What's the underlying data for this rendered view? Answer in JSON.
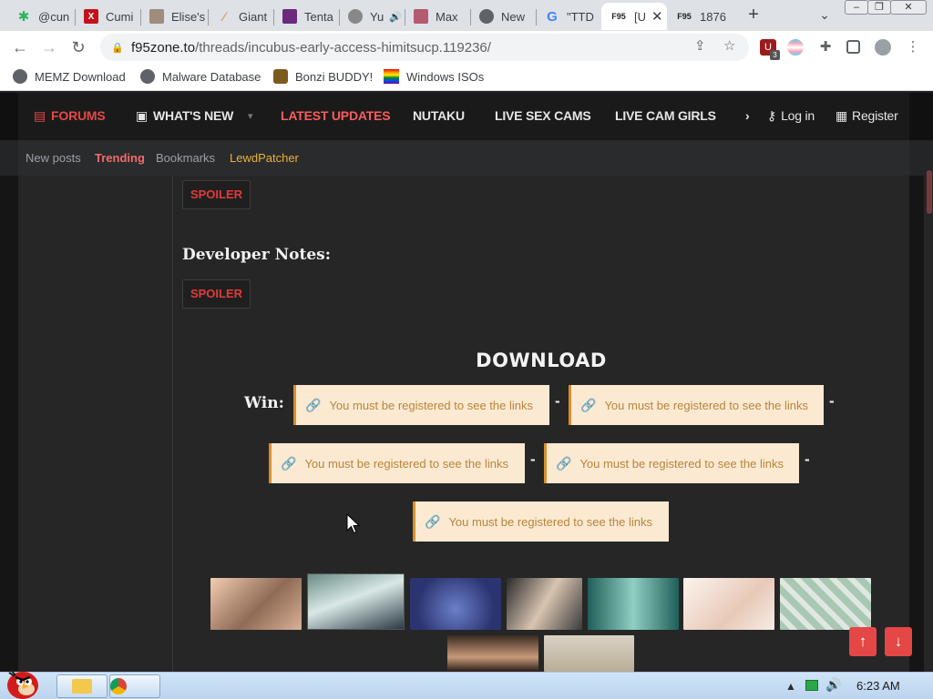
{
  "tabs": [
    {
      "title": "@cun",
      "icon": "cannabis-leaf-icon",
      "color": "#2bb55b"
    },
    {
      "title": "Cumi",
      "icon": "x-icon",
      "color": "#c4121a"
    },
    {
      "title": "Elise's",
      "icon": "thumbnail-icon",
      "color": "#a08c7c"
    },
    {
      "title": "Giant",
      "icon": "brush-icon",
      "color": "#caa462"
    },
    {
      "title": "Tenta",
      "icon": "thumbnail-icon",
      "color": "#6c2a7d"
    },
    {
      "title": "Yu",
      "icon": "avatar-icon",
      "color": "#888888"
    },
    {
      "title": "Max",
      "icon": "thumbnail-icon",
      "color": "#b35b70"
    },
    {
      "title": "New",
      "icon": "globe-icon",
      "color": "#5f6368"
    },
    {
      "title": "\"TTD",
      "icon": "google-icon",
      "color": "#4285f4"
    },
    {
      "title": "[U",
      "icon": "f95-icon",
      "color": "#c1272d"
    },
    {
      "title": "1876",
      "icon": "f95-icon",
      "color": "#c1272d"
    }
  ],
  "address": {
    "domain": "f95zone.to",
    "path": "/threads/incubus-early-access-himitsucp.119236/"
  },
  "ext_badge": "3",
  "bookmarks": [
    {
      "label": "MEMZ Download",
      "icon": "globe-icon"
    },
    {
      "label": "Malware Database",
      "icon": "globe-icon"
    },
    {
      "label": "Bonzi BUDDY!",
      "icon": "bonzi-icon"
    },
    {
      "label": "Windows ISOs",
      "icon": "windows-icon"
    }
  ],
  "site_nav": {
    "forums": "FORUMS",
    "whats_new": "WHAT'S NEW",
    "latest_updates": "LATEST UPDATES",
    "nutaku": "NUTAKU",
    "live_sex_cams": "LIVE SEX CAMS",
    "live_cam_girls": "LIVE CAM GIRLS",
    "login": "Log in",
    "register": "Register"
  },
  "sub_nav": {
    "new_posts": "New posts",
    "trending": "Trending",
    "bookmarks": "Bookmarks",
    "lewdpatcher": "LewdPatcher"
  },
  "post": {
    "spoiler_label": "SPOILER",
    "developer_notes": "Developer Notes:",
    "download_title": "DOWNLOAD",
    "win_label": "Win:",
    "link_text": "You must be registered to see the links",
    "dash": "-"
  },
  "taskbar": {
    "clock": "6:23 AM"
  },
  "colors": {
    "accent_red": "#e33a3a",
    "latest_updates": "#ff5b5b",
    "lewdpatcher": "#e8b23a",
    "link_bg": "#fbe9d2",
    "link_text": "#b7853a"
  }
}
